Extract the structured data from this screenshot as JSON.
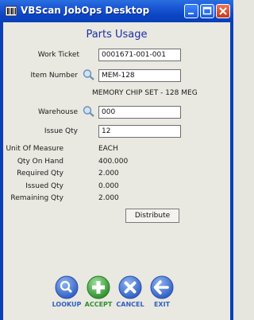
{
  "window": {
    "title": "VBScan JobOps Desktop"
  },
  "heading": "Parts Usage",
  "form": {
    "work_ticket_label": "Work Ticket",
    "work_ticket_value": "0001671-001-001",
    "item_number_label": "Item Number",
    "item_number_value": "MEM-128",
    "item_description": "MEMORY CHIP SET - 128 MEG",
    "warehouse_label": "Warehouse",
    "warehouse_value": "000",
    "issue_qty_label": "Issue Qty",
    "issue_qty_value": "12"
  },
  "info": {
    "uom_label": "Unit Of Measure",
    "uom_value": "EACH",
    "on_hand_label": "Qty On Hand",
    "on_hand_value": "400.000",
    "required_label": "Required Qty",
    "required_value": "2.000",
    "issued_label": "Issued Qty",
    "issued_value": "0.000",
    "remaining_label": "Remaining Qty",
    "remaining_value": "2.000"
  },
  "buttons": {
    "distribute": "Distribute",
    "lookup": "LOOKUP",
    "accept": "ACCEPT",
    "cancel": "CANCEL",
    "exit": "EXIT"
  },
  "colors": {
    "titlebar": "#0b45c4",
    "heading": "#1b2fa4",
    "lookup": "#3b6fd1",
    "accept": "#3aa23a",
    "cancel": "#3b6fd1",
    "exit": "#3b6fd1"
  }
}
